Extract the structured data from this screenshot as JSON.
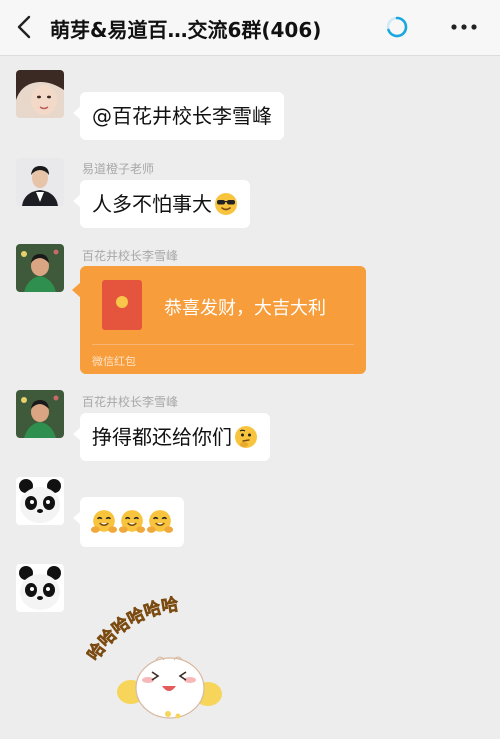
{
  "header": {
    "title": "萌芽&易道百…交流6群(406)"
  },
  "messages": [
    {
      "sender": "",
      "text": "@百花井校长李雪峰"
    },
    {
      "sender": "易道橙子老师",
      "text": "人多不怕事大",
      "emoji": "sunglasses-emoji"
    },
    {
      "sender": "百花井校长李雪峰",
      "red_packet": {
        "greeting": "恭喜发财，大吉大利",
        "footer": "微信红包"
      }
    },
    {
      "sender": "百花井校长李雪峰",
      "text": "挣得都还给你们",
      "emoji": "thinking-emoji"
    },
    {
      "sender": "",
      "emojis": [
        "hugging-emoji",
        "hugging-emoji",
        "hugging-emoji"
      ]
    },
    {
      "sender": "",
      "sticker": {
        "caption": "哈哈哈哈哈哈"
      }
    }
  ],
  "colors": {
    "background": "#ededed",
    "bubble": "#ffffff",
    "red_packet": "#f79d3b",
    "loader": "#1aa7e0"
  }
}
